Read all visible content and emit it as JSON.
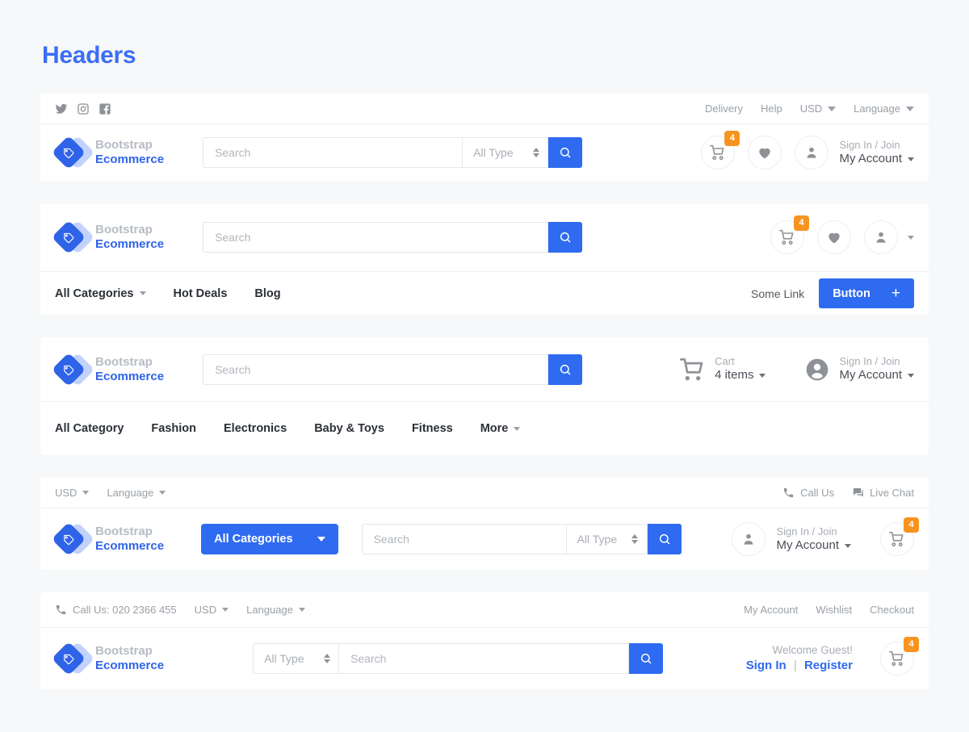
{
  "page": {
    "title": "Headers"
  },
  "brand": {
    "line1": "Bootstrap",
    "line2": "Ecommerce",
    "logo_icon": "diamond-tag-logo-icon"
  },
  "colors": {
    "accent": "#2f6bf0",
    "brand_light": "#c3d2fb",
    "badge": "#f79421",
    "page_bg": "#f7f8f9",
    "card_bg": "#ffffff",
    "muted_text": "#9aa0a6"
  },
  "header1": {
    "socials": [
      {
        "name": "twitter-icon"
      },
      {
        "name": "instagram-icon"
      },
      {
        "name": "facebook-icon"
      }
    ],
    "top_links": [
      {
        "label": "Delivery",
        "caret": false
      },
      {
        "label": "Help",
        "caret": false
      },
      {
        "label": "USD",
        "caret": true
      },
      {
        "label": "Language",
        "caret": true
      }
    ],
    "search": {
      "placeholder": "Search",
      "value": "",
      "type_label": "All Type",
      "button_icon": "search-icon"
    },
    "cart": {
      "badge": "4",
      "icon": "cart-icon"
    },
    "wishlist": {
      "icon": "heart-icon"
    },
    "account": {
      "icon": "user-icon",
      "line1": "Sign In / Join",
      "line2": "My Account"
    }
  },
  "header2": {
    "search": {
      "placeholder": "Search",
      "value": "",
      "button_icon": "search-icon"
    },
    "cart": {
      "badge": "4",
      "icon": "cart-icon"
    },
    "wishlist": {
      "icon": "heart-icon"
    },
    "account": {
      "icon": "user-icon"
    },
    "nav": [
      {
        "label": "All Categories",
        "caret": true
      },
      {
        "label": "Hot Deals",
        "caret": false
      },
      {
        "label": "Blog",
        "caret": false
      }
    ],
    "some_link": "Some Link",
    "button": {
      "label": "Button",
      "icon": "plus-icon"
    }
  },
  "header3": {
    "search": {
      "placeholder": "Search",
      "value": "",
      "button_icon": "search-icon"
    },
    "cart": {
      "icon": "cart-icon",
      "line1": "Cart",
      "line2": "4 items"
    },
    "account": {
      "icon": "user-circle-icon",
      "line1": "Sign In / Join",
      "line2": "My Account"
    },
    "nav": [
      {
        "label": "All Category",
        "caret": false
      },
      {
        "label": "Fashion",
        "caret": false
      },
      {
        "label": "Electronics",
        "caret": false
      },
      {
        "label": "Baby & Toys",
        "caret": false
      },
      {
        "label": "Fitness",
        "caret": false
      },
      {
        "label": "More",
        "caret": true
      }
    ]
  },
  "header4": {
    "top_left": [
      {
        "label": "USD",
        "caret": true
      },
      {
        "label": "Language",
        "caret": true
      }
    ],
    "top_right": [
      {
        "label": "Call Us",
        "icon": "phone-icon"
      },
      {
        "label": "Live Chat",
        "icon": "chat-icon"
      }
    ],
    "categories_button": {
      "label": "All Categories"
    },
    "search": {
      "placeholder": "Search",
      "value": "",
      "type_label": "All Type",
      "button_icon": "search-icon"
    },
    "account": {
      "icon": "user-icon",
      "line1": "Sign In / Join",
      "line2": "My Account"
    },
    "cart": {
      "badge": "4",
      "icon": "cart-icon"
    }
  },
  "header5": {
    "call_us": {
      "label": "Call Us: 020 2366 455",
      "icon": "phone-icon"
    },
    "top_left": [
      {
        "label": "USD",
        "caret": true
      },
      {
        "label": "Language",
        "caret": true
      }
    ],
    "top_right": [
      {
        "label": "My Account"
      },
      {
        "label": "Wishlist"
      },
      {
        "label": "Checkout"
      }
    ],
    "search": {
      "placeholder": "Search",
      "value": "",
      "type_label": "All Type",
      "button_icon": "search-icon"
    },
    "welcome": {
      "greeting": "Welcome Guest!",
      "sign_in": "Sign In",
      "separator": "|",
      "register": "Register"
    },
    "cart": {
      "badge": "4",
      "icon": "cart-icon"
    }
  }
}
